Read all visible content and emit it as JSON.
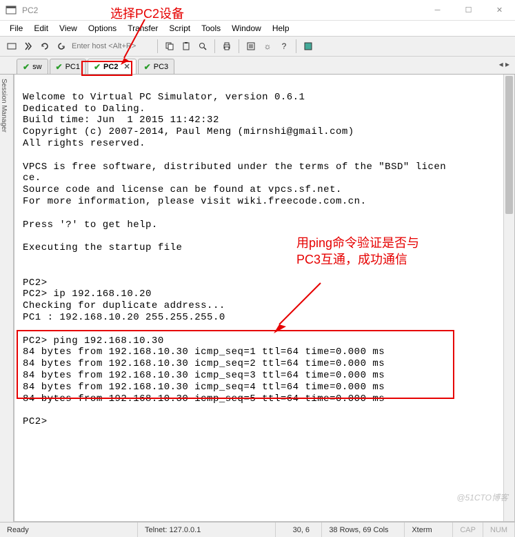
{
  "window": {
    "title": "PC2"
  },
  "menu": {
    "items": [
      "File",
      "Edit",
      "View",
      "Options",
      "Transfer",
      "Script",
      "Tools",
      "Window",
      "Help"
    ]
  },
  "toolbar": {
    "host_placeholder": "Enter host <Alt+R>"
  },
  "tabs": [
    {
      "label": "sw",
      "active": false
    },
    {
      "label": "PC1",
      "active": false
    },
    {
      "label": "PC2",
      "active": true
    },
    {
      "label": "PC3",
      "active": false
    }
  ],
  "side_tab": {
    "label": "Session Manager"
  },
  "terminal": {
    "lines": [
      "",
      "Welcome to Virtual PC Simulator, version 0.6.1",
      "Dedicated to Daling.",
      "Build time: Jun  1 2015 11:42:32",
      "Copyright (c) 2007-2014, Paul Meng (mirnshi@gmail.com)",
      "All rights reserved.",
      "",
      "VPCS is free software, distributed under the terms of the \"BSD\" licen",
      "ce.",
      "Source code and license can be found at vpcs.sf.net.",
      "For more information, please visit wiki.freecode.com.cn.",
      "",
      "Press '?' to get help.",
      "",
      "Executing the startup file",
      "",
      "",
      "PC2>",
      "PC2> ip 192.168.10.20",
      "Checking for duplicate address...",
      "PC1 : 192.168.10.20 255.255.255.0",
      "",
      "PC2> ping 192.168.10.30",
      "84 bytes from 192.168.10.30 icmp_seq=1 ttl=64 time=0.000 ms",
      "84 bytes from 192.168.10.30 icmp_seq=2 ttl=64 time=0.000 ms",
      "84 bytes from 192.168.10.30 icmp_seq=3 ttl=64 time=0.000 ms",
      "84 bytes from 192.168.10.30 icmp_seq=4 ttl=64 time=0.000 ms",
      "84 bytes from 192.168.10.30 icmp_seq=5 ttl=64 time=0.000 ms",
      "",
      "PC2>"
    ]
  },
  "statusbar": {
    "ready": "Ready",
    "connection": "Telnet: 127.0.0.1",
    "position": "30,  6",
    "dimensions": "38 Rows, 69 Cols",
    "term": "Xterm",
    "caps": "CAP",
    "num": "NUM"
  },
  "annotations": {
    "top_label": "选择PC2设备",
    "side_label": "用ping命令验证是否与PC3互通，成功通信"
  },
  "watermark": "@51CTO博客"
}
